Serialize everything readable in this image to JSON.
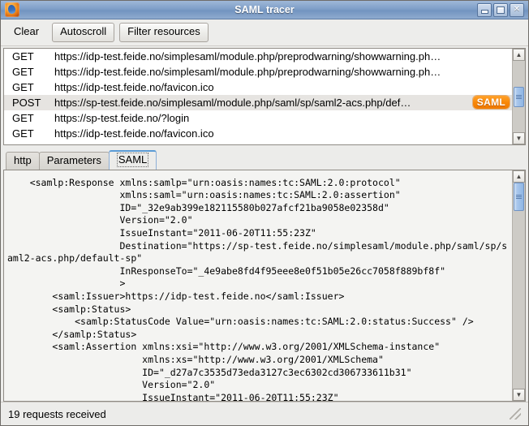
{
  "window": {
    "title": "SAML tracer",
    "icon": "firefox-icon",
    "buttons": {
      "minimize": "_",
      "maximize": "□",
      "close": "✕"
    }
  },
  "toolbar": {
    "clear_label": "Clear",
    "autoscroll_label": "Autoscroll",
    "filter_label": "Filter resources"
  },
  "request_list": {
    "rows": [
      {
        "method": "GET",
        "url": "https://idp-test.feide.no/simplesaml/module.php/preprodwarning/showwarning.ph…",
        "badge": "",
        "selected": false
      },
      {
        "method": "GET",
        "url": "https://idp-test.feide.no/simplesaml/module.php/preprodwarning/showwarning.ph…",
        "badge": "",
        "selected": false
      },
      {
        "method": "GET",
        "url": "https://idp-test.feide.no/favicon.ico",
        "badge": "",
        "selected": false
      },
      {
        "method": "POST",
        "url": "https://sp-test.feide.no/simplesaml/module.php/saml/sp/saml2-acs.php/def…",
        "badge": "SAML",
        "selected": true
      },
      {
        "method": "GET",
        "url": "https://sp-test.feide.no/?login",
        "badge": "",
        "selected": false
      },
      {
        "method": "GET",
        "url": "https://idp-test.feide.no/favicon.ico",
        "badge": "",
        "selected": false
      }
    ],
    "scroll_up_icon": "▲",
    "scroll_down_icon": "▼"
  },
  "tabs": [
    {
      "label": "http",
      "active": false
    },
    {
      "label": "Parameters",
      "active": false
    },
    {
      "label": "SAML",
      "active": true
    }
  ],
  "detail": {
    "scroll_up_icon": "▲",
    "scroll_down_icon": "▼",
    "xml": "    <samlp:Response xmlns:samlp=\"urn:oasis:names:tc:SAML:2.0:protocol\"\n                    xmlns:saml=\"urn:oasis:names:tc:SAML:2.0:assertion\"\n                    ID=\"_32e9ab399e182115580b027afcf21ba9058e02358d\"\n                    Version=\"2.0\"\n                    IssueInstant=\"2011-06-20T11:55:23Z\"\n                    Destination=\"https://sp-test.feide.no/simplesaml/module.php/saml/sp/saml2-acs.php/default-sp\"\n                    InResponseTo=\"_4e9abe8fd4f95eee8e0f51b05e26cc7058f889bf8f\"\n                    >\n        <saml:Issuer>https://idp-test.feide.no</saml:Issuer>\n        <samlp:Status>\n            <samlp:StatusCode Value=\"urn:oasis:names:tc:SAML:2.0:status:Success\" />\n        </samlp:Status>\n        <saml:Assertion xmlns:xsi=\"http://www.w3.org/2001/XMLSchema-instance\"\n                        xmlns:xs=\"http://www.w3.org/2001/XMLSchema\"\n                        ID=\"_d27a7c3535d73eda3127c3ec6302cd306733611b31\"\n                        Version=\"2.0\"\n                        IssueInstant=\"2011-06-20T11:55:23Z\""
  },
  "statusbar": {
    "message": "19 requests received"
  },
  "colors": {
    "titlebar": "#7f9fc8",
    "badge": "#f88607",
    "selection": "#e6e4e1",
    "scroll_thumb": "#8fb6e4",
    "active_tab_top": "#5b9bd5"
  }
}
